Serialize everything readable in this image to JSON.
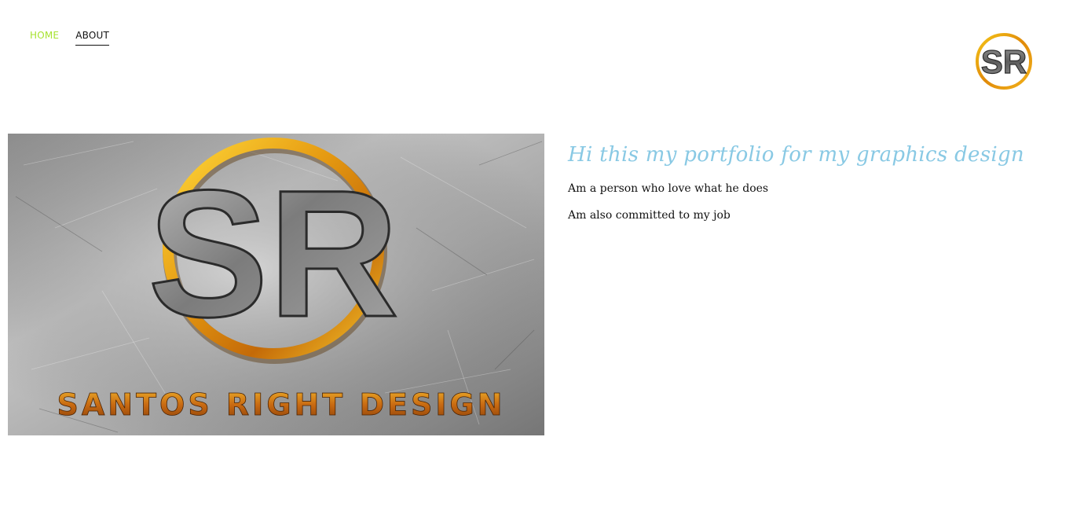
{
  "nav": {
    "home_label": "HOME",
    "about_label": "ABOUT",
    "active_color": "#a7e22f"
  },
  "header_logo": {
    "icon": "sr-logo-icon",
    "monogram": "SR"
  },
  "hero": {
    "icon": "santos-right-design-banner",
    "monogram": "SR",
    "caption": "SANTOS RIGHT DESIGN"
  },
  "content": {
    "headline": "Hi this my portfolio for my graphics design",
    "paragraph_1": "Am a person who love what he does",
    "paragraph_2": "Am also committed to my job",
    "headline_color": "#89c9e4"
  }
}
